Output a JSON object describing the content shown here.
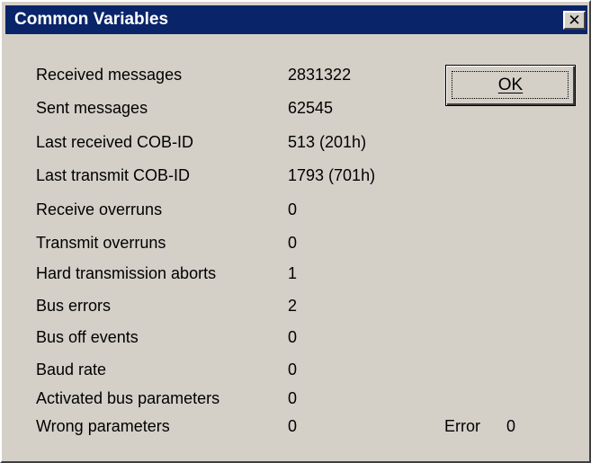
{
  "window": {
    "title": "Common Variables",
    "close_glyph": "✕",
    "titlebar_color": "#0a246a",
    "background_color": "#d4d0c8"
  },
  "stats": [
    {
      "label": "Received messages",
      "value": "2831322"
    },
    {
      "label": "Sent messages",
      "value": "62545"
    },
    {
      "label": "Last received COB-ID",
      "value": "513 (201h)"
    },
    {
      "label": "Last transmit COB-ID",
      "value": "1793 (701h)"
    },
    {
      "label": "Receive overruns",
      "value": "0"
    },
    {
      "label": "Transmit overruns",
      "value": "0"
    },
    {
      "label": "Hard transmission aborts",
      "value": "1"
    },
    {
      "label": "Bus errors",
      "value": "2"
    },
    {
      "label": "Bus off events",
      "value": "0"
    },
    {
      "label": "Baud rate",
      "value": "0"
    },
    {
      "label": "Activated bus parameters",
      "value": "0"
    },
    {
      "label": "Wrong parameters",
      "value": "0"
    }
  ],
  "ok_button": {
    "label": "OK"
  },
  "error": {
    "label": "Error",
    "value": "0"
  }
}
